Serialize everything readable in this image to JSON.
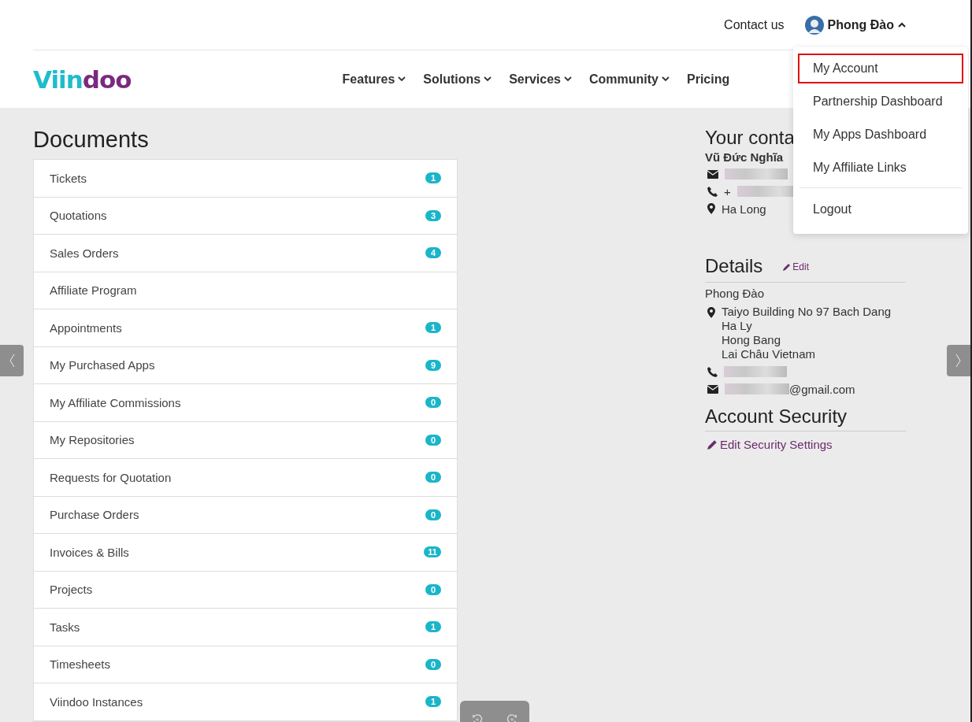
{
  "logo": [
    "Viin",
    "doo"
  ],
  "top_bar": {
    "contact_link": "Contact us",
    "user_name": "Phong Đào",
    "menu_open": true
  },
  "nav": {
    "items": [
      {
        "label": "Features",
        "has_submenu": true
      },
      {
        "label": "Solutions",
        "has_submenu": true
      },
      {
        "label": "Services",
        "has_submenu": true
      },
      {
        "label": "Community",
        "has_submenu": true
      },
      {
        "label": "Pricing",
        "has_submenu": false
      }
    ]
  },
  "user_menu": {
    "items": [
      {
        "label": "My Account",
        "highlighted": true
      },
      {
        "label": "Partnership Dashboard",
        "highlighted": false
      },
      {
        "label": "My Apps Dashboard",
        "highlighted": false
      },
      {
        "label": "My Affiliate Links",
        "highlighted": false
      }
    ],
    "logout": "Logout"
  },
  "documents": {
    "title": "Documents",
    "items": [
      {
        "label": "Tickets",
        "count": "1"
      },
      {
        "label": "Quotations",
        "count": "3"
      },
      {
        "label": "Sales Orders",
        "count": "4"
      },
      {
        "label": "Affiliate Program"
      },
      {
        "label": "Appointments",
        "count": "1"
      },
      {
        "label": "My Purchased Apps",
        "count": "9"
      },
      {
        "label": "My Affiliate Commissions",
        "count": "0"
      },
      {
        "label": "My Repositories",
        "count": "0"
      },
      {
        "label": "Requests for Quotation",
        "count": "0"
      },
      {
        "label": "Purchase Orders",
        "count": "0"
      },
      {
        "label": "Invoices & Bills",
        "count": "11"
      },
      {
        "label": "Projects",
        "count": "0"
      },
      {
        "label": "Tasks",
        "count": "1"
      },
      {
        "label": "Timesheets",
        "count": "0"
      },
      {
        "label": "Viindoo Instances",
        "count": "1"
      }
    ]
  },
  "contact": {
    "title": "Your conta",
    "name": "Vũ Đức Nghĩa",
    "phone_prefix": "+",
    "city": "Ha Long"
  },
  "details": {
    "title": "Details",
    "edit": "Edit",
    "name": "Phong Đào",
    "address": [
      "Taiyo Building No 97 Bach Dang",
      "Ha Ly",
      "Hong Bang",
      "Lai Châu Vietnam"
    ],
    "email_suffix": "@gmail.com"
  },
  "security": {
    "title": "Account Security",
    "link": "Edit Security Settings"
  }
}
